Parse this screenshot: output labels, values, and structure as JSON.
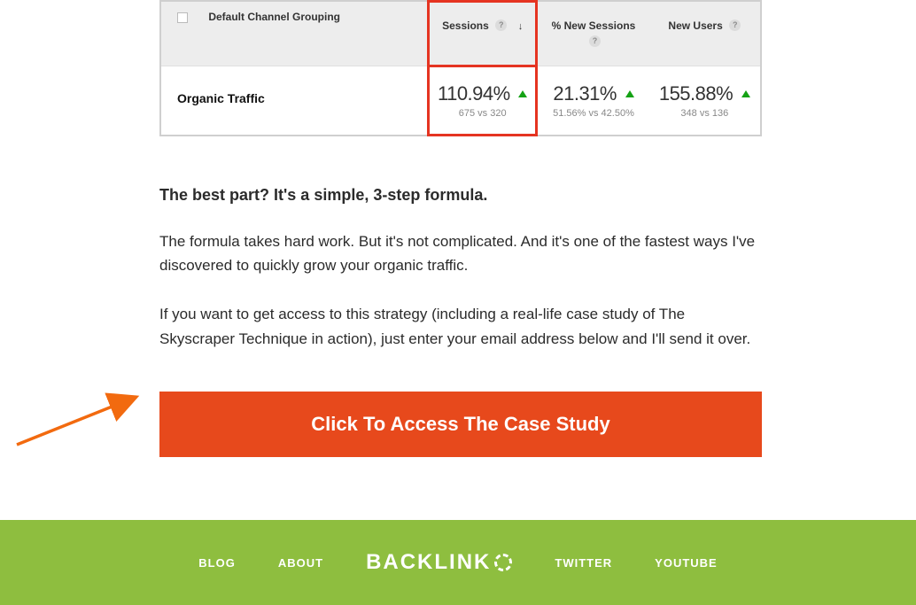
{
  "table": {
    "dimension_header": "Default Channel Grouping",
    "columns": {
      "sessions": "Sessions",
      "pct_new": "% New Sessions",
      "new_users": "New Users"
    },
    "row_label": "Organic Traffic",
    "metrics": {
      "sessions": {
        "pct": "110.94%",
        "sub": "675 vs 320"
      },
      "pct_new": {
        "pct": "21.31%",
        "sub": "51.56% vs 42.50%"
      },
      "new_users": {
        "pct": "155.88%",
        "sub": "348 vs 136"
      }
    }
  },
  "body": {
    "headline": "The best part? It's a simple, 3-step formula.",
    "p1": "The formula takes hard work. But it's not complicated. And it's one of the fastest ways I've discovered to quickly grow your organic traffic.",
    "p2": "If you want to get access to this strategy (including a real-life case study of The Skyscraper Technique in action), just enter your email address below and I'll send it over."
  },
  "cta_label": "Click To Access The Case Study",
  "footer": {
    "links": {
      "blog": "BLOG",
      "about": "ABOUT",
      "twitter": "TWITTER",
      "youtube": "YOUTUBE"
    },
    "brand": "BACKLINK"
  }
}
